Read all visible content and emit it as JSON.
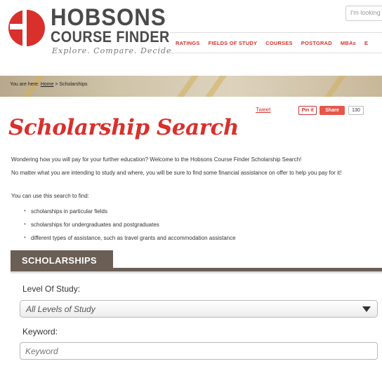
{
  "header": {
    "logo_title": "HOBSONS",
    "logo_subtitle": "COURSE FINDER",
    "logo_tagline": "Explore. Compare. Decide",
    "search_placeholder": "I'm looking",
    "nav": [
      "RATINGS",
      "FIELDS OF STUDY",
      "COURSES",
      "POSTGRAD",
      "MBAs",
      "E"
    ]
  },
  "breadcrumb": {
    "prefix": "You are here:",
    "home": "Home",
    "separator": ">",
    "current": "Scholarships"
  },
  "share": {
    "tweet": "Tweet",
    "pin": "Pin it",
    "share": "Share",
    "count": "130"
  },
  "page_title": "Scholarship Search",
  "intro": {
    "p1": "Wondering how you will pay for your further education? Welcome to the Hobsons Course Finder Scholarship Search!",
    "p2": "No matter what you are intending to study and where, you will be sure to find some financial assistance on offer to help you pay for it!",
    "p3": "You can use this search to find:",
    "bullets": [
      "scholarships in particular fields",
      "scholarships for undergraduates and postgraduates",
      "different types of assistance, such as travel grants and accommodation assistance"
    ]
  },
  "tab": {
    "label": "SCHOLARSHIPS"
  },
  "form": {
    "level_label": "Level Of Study:",
    "level_value": "All Levels of Study",
    "keyword_label": "Keyword:",
    "keyword_placeholder": "Keyword"
  },
  "colors": {
    "brand_red": "#d9302c",
    "tab_brown": "#6a5e55"
  },
  "icons": {
    "logo": "hobsons-logo-mark",
    "dropdown": "chevron-down-icon"
  }
}
